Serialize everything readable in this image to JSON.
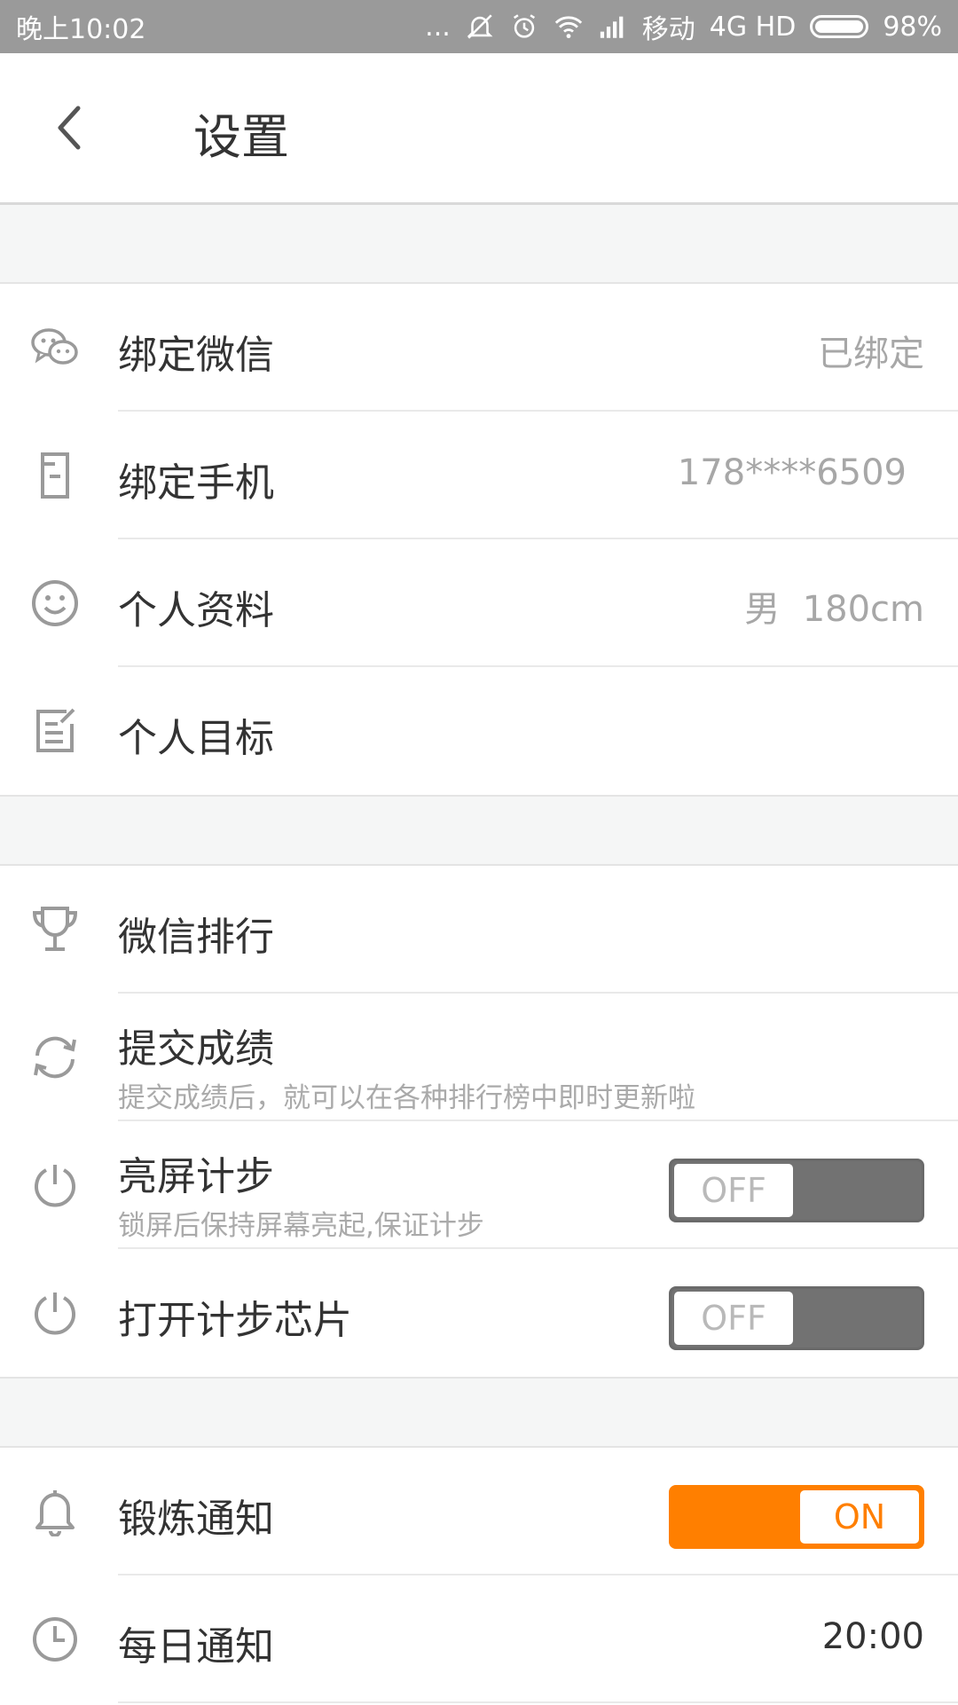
{
  "status": {
    "time": "晚上10:02",
    "dots": "...",
    "carrier": "移动",
    "network": "4G HD",
    "battery": "98%"
  },
  "header": {
    "title": "设置"
  },
  "sections": [
    {
      "items": [
        {
          "icon": "wechat-icon",
          "label": "绑定微信",
          "value": "已绑定"
        },
        {
          "icon": "phone-icon",
          "label": "绑定手机",
          "value": "178****6509"
        },
        {
          "icon": "smiley-icon",
          "label": "个人资料",
          "value": "男  180cm"
        },
        {
          "icon": "goal-edit-icon",
          "label": "个人目标"
        }
      ]
    },
    {
      "items": [
        {
          "icon": "trophy-icon",
          "label": "微信排行"
        },
        {
          "icon": "refresh-icon",
          "label": "提交成绩",
          "sub": "提交成绩后，就可以在各种排行榜中即时更新啦"
        },
        {
          "icon": "power-icon",
          "label": "亮屏计步",
          "sub": "锁屏后保持屏幕亮起,保证计步",
          "toggle": "OFF"
        },
        {
          "icon": "power-icon",
          "label": "打开计步芯片",
          "toggle": "OFF"
        }
      ]
    },
    {
      "items": [
        {
          "icon": "bell-icon",
          "label": "锻炼通知",
          "toggle": "ON"
        },
        {
          "icon": "clock-icon",
          "label": "每日通知",
          "value": "20:00"
        }
      ]
    }
  ],
  "colors": {
    "accent": "#ff7f00",
    "statusbar": "#9a9a9a",
    "toggle_off": "#727272"
  }
}
